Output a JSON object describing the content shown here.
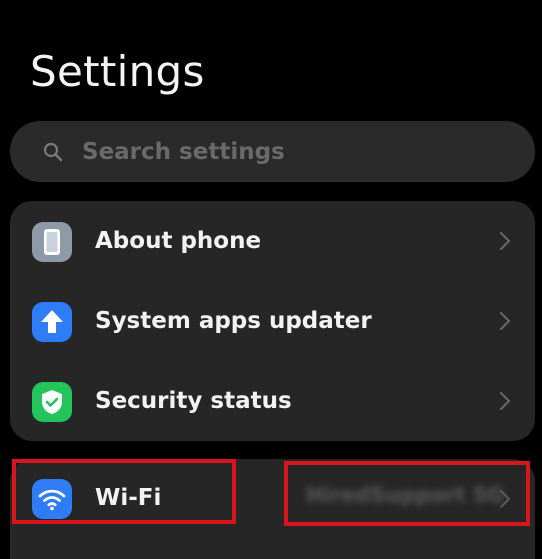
{
  "header": {
    "title": "Settings"
  },
  "search": {
    "placeholder": "Search settings",
    "icon": "search-icon"
  },
  "settings_items": [
    {
      "label": "About phone",
      "icon": "phone-icon",
      "icon_color": "#8e9aa8"
    },
    {
      "label": "System apps updater",
      "icon": "arrow-up-icon",
      "icon_color": "#2e7cf6"
    },
    {
      "label": "Security status",
      "icon": "shield-check-icon",
      "icon_color": "#23c45a"
    }
  ],
  "wifi": {
    "label": "Wi-Fi",
    "icon": "wifi-icon",
    "icon_color": "#2e7cf6",
    "network_name": "HiredSupport 5G"
  },
  "colors": {
    "background": "#000000",
    "card": "#262626",
    "highlight": "#d8141c"
  }
}
